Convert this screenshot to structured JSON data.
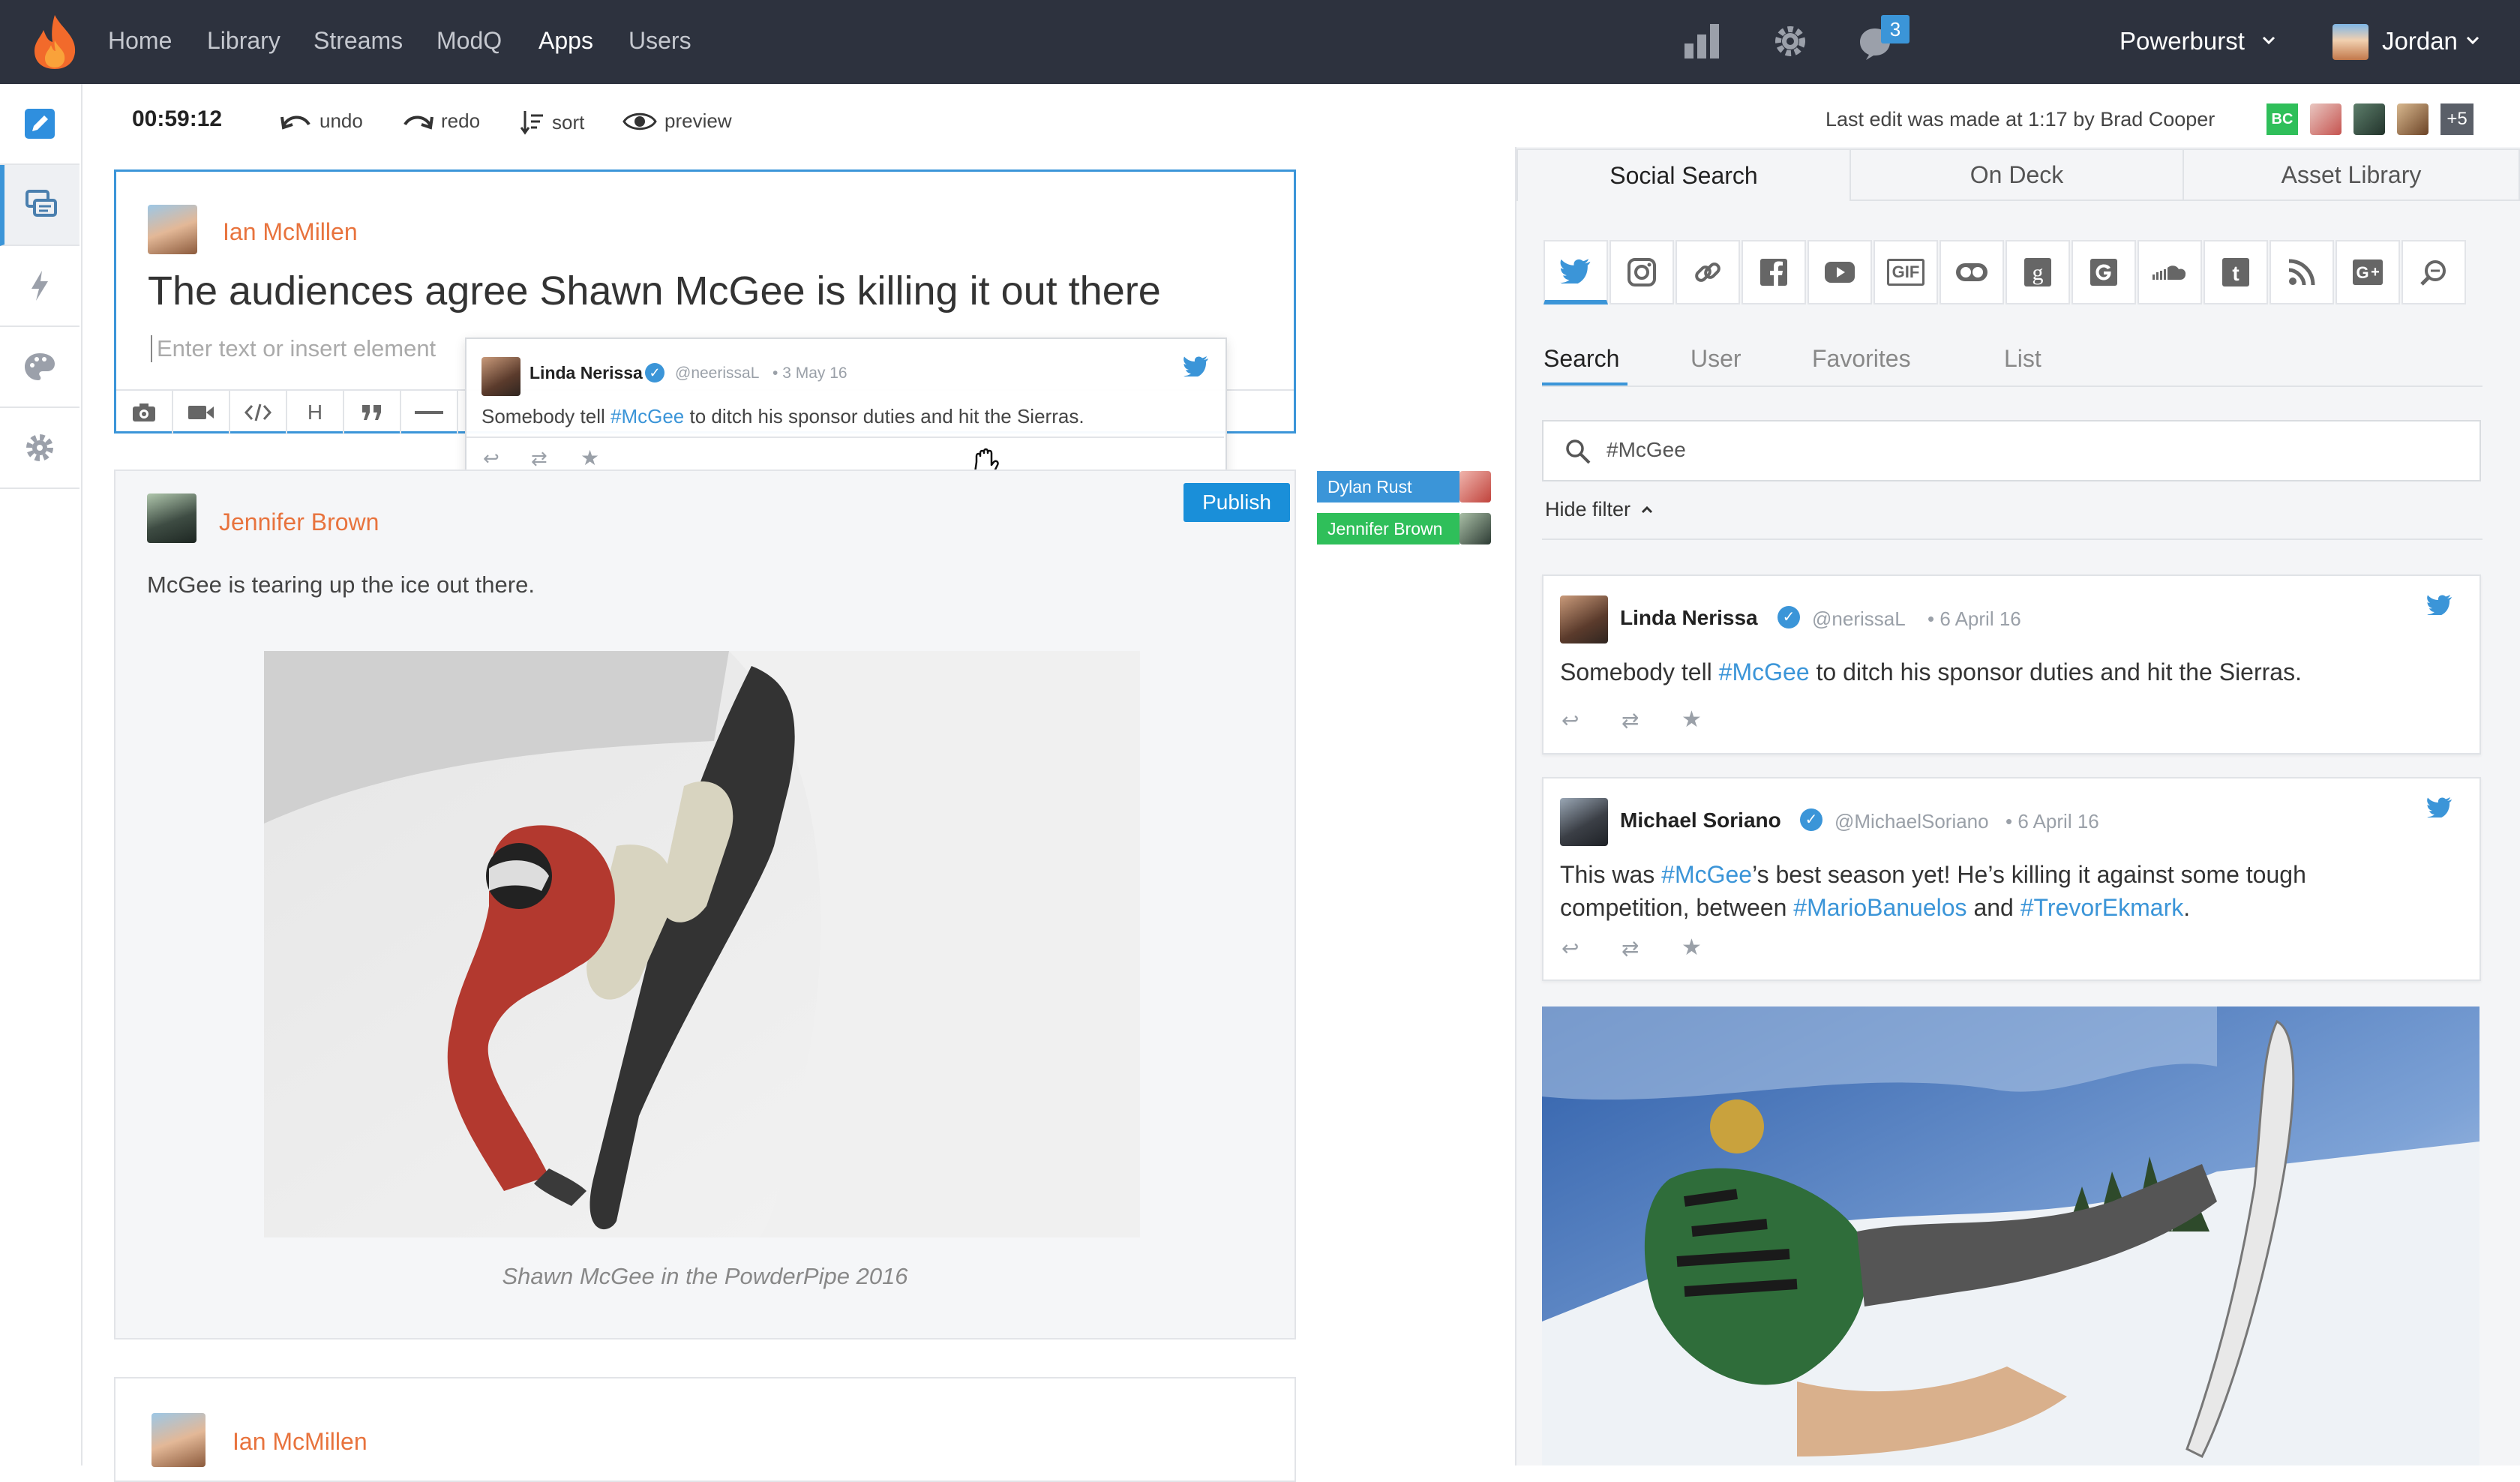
{
  "nav": {
    "links": [
      "Home",
      "Library",
      "Streams",
      "ModQ",
      "Apps",
      "Users"
    ],
    "active": "Apps",
    "notification_count": "3",
    "workspace": "Powerburst",
    "user": "Jordan"
  },
  "toolbar": {
    "timer": "00:59:12",
    "undo": "undo",
    "redo": "redo",
    "sort": "sort",
    "preview": "preview",
    "last_edit": "Last edit was made at 1:17 by Brad Cooper",
    "collab_badge": "BC",
    "collab_more": "+5"
  },
  "editor": {
    "author": "Ian McMillen",
    "headline": "The audiences agree Shawn McGee is killing it out there",
    "placeholder": "Enter text or insert element",
    "tools": [
      "camera",
      "video",
      "code",
      "heading",
      "quote",
      "divider"
    ],
    "heading_label": "H"
  },
  "drag_tweet": {
    "name": "Linda Nerissa",
    "handle": "@neerissaL",
    "date": "3 May 16",
    "text_pre": "Somebody tell ",
    "hashtag": "#McGee",
    "text_post": " to ditch his sponsor duties and hit the Sierras."
  },
  "post": {
    "author": "Jennifer Brown",
    "publish": "Publish",
    "body": "McGee is tearing up the ice out there.",
    "caption": "Shawn McGee in the PowderPipe 2016"
  },
  "presence": [
    {
      "name": "Dylan Rust",
      "color": "#3b95d8"
    },
    {
      "name": "Jennifer Brown",
      "color": "#2fbf5a"
    }
  ],
  "next_post": {
    "author": "Ian McMillen"
  },
  "panel": {
    "tabs": [
      "Social Search",
      "On Deck",
      "Asset Library"
    ],
    "active_tab": "Social Search",
    "sources": [
      "twitter",
      "instagram",
      "link",
      "facebook",
      "youtube",
      "GIF",
      "flickr",
      "goodreads",
      "google",
      "soundcloud",
      "tumblr",
      "rss",
      "google-plus",
      "search"
    ],
    "subtabs": [
      "Search",
      "User",
      "Favorites",
      "List"
    ],
    "active_subtab": "Search",
    "search_value": "#McGee",
    "hide_filter": "Hide filter"
  },
  "results": [
    {
      "name": "Linda Nerissa",
      "handle": "@nerissaL",
      "date": "6 April 16",
      "line1": [
        {
          "t": "Somebody tell ",
          "h": false
        },
        {
          "t": "#McGee",
          "h": true
        },
        {
          "t": " to ditch his sponsor duties and hit the Sierras.",
          "h": false
        }
      ]
    },
    {
      "name": "Michael Soriano",
      "handle": "@MichaelSoriano",
      "date": "6 April 16",
      "line1": [
        {
          "t": "This was ",
          "h": false
        },
        {
          "t": "#McGee",
          "h": true
        },
        {
          "t": "’s best season yet! He’s killing it against some tough",
          "h": false
        }
      ],
      "line2": [
        {
          "t": "competition, between ",
          "h": false
        },
        {
          "t": "#MarioBanuelos",
          "h": true
        },
        {
          "t": " and ",
          "h": false
        },
        {
          "t": "#TrevorEkmark",
          "h": true
        },
        {
          "t": ".",
          "h": false
        }
      ]
    }
  ],
  "colors": {
    "nav_bg": "#2d323e",
    "accent": "#3b95d8",
    "author": "#e8733d",
    "publish": "#1a8fd9",
    "online": "#2fbf5a"
  }
}
